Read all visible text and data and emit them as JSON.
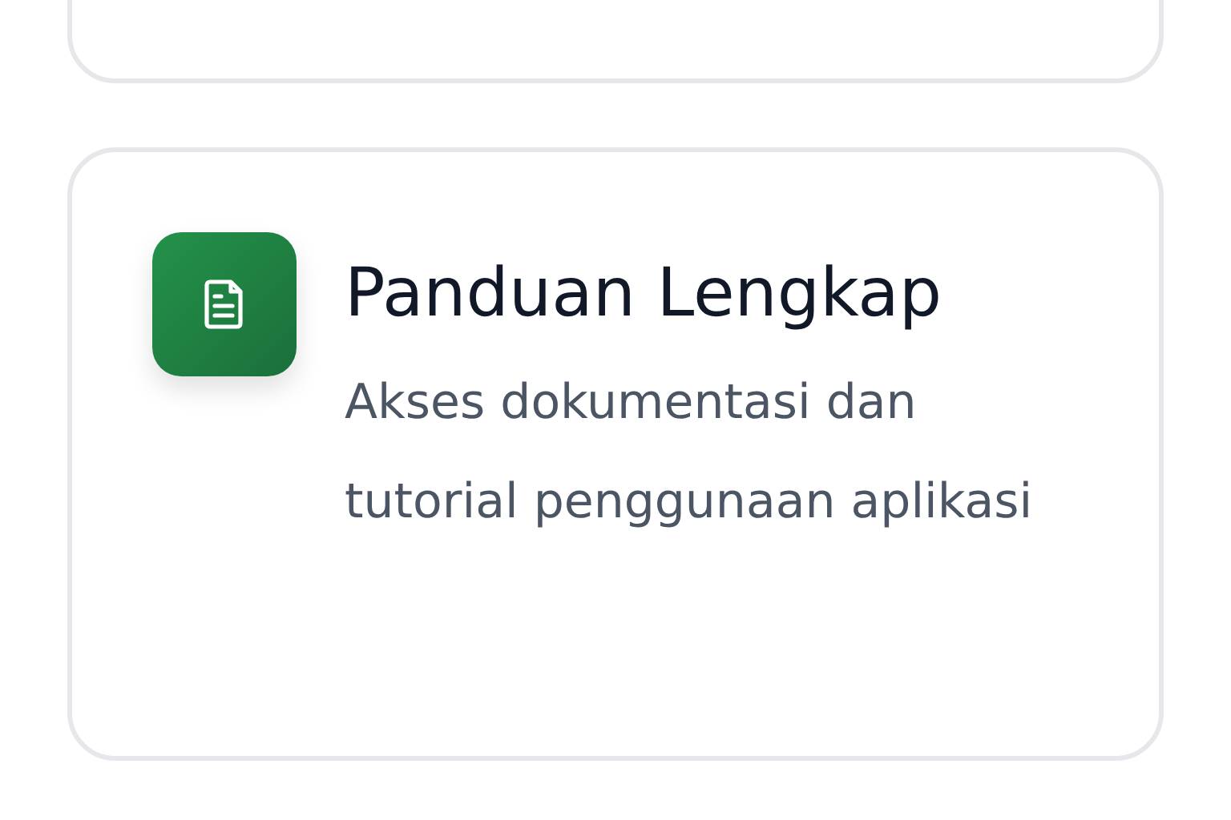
{
  "cards": [
    {
      "kind": "empty"
    },
    {
      "kind": "feature",
      "title": "Panduan Lengkap",
      "description": "Akses dokumentasi dan tutorial penggunaan aplikasi"
    }
  ]
}
